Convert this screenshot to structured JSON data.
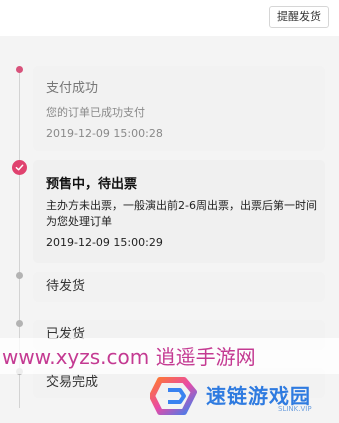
{
  "header": {
    "remind_label": "提醒发货"
  },
  "timeline": {
    "steps": [
      {
        "title": "支付成功",
        "desc": "您的订单已成功支付",
        "time": "2019-12-09 15:00:28"
      },
      {
        "title": "预售中，待出票",
        "desc": "主办方未出票，一般演出前2-6周出票，出票后第一时间为您处理订单",
        "time": "2019-12-09 15:00:29"
      },
      {
        "title": "待发货"
      },
      {
        "title": "已发货"
      },
      {
        "title": "交易完成"
      }
    ]
  },
  "watermark": {
    "left_text": "www.xyzs.com 逍遥手游网",
    "right_text": "速链游戏园",
    "right_sub": "SLINK.VIP"
  },
  "colors": {
    "accent": "#e0426f",
    "pending_dot": "#b3b3b3",
    "watermark_pink": "#c43a92",
    "watermark_blue": "#2f7be0"
  }
}
